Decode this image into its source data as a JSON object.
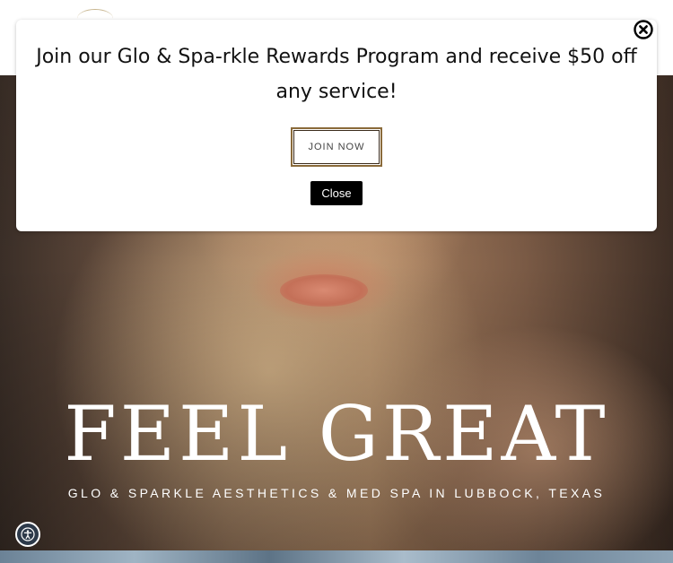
{
  "popup": {
    "message": "Join our Glo & Spa-rkle Rewards Program and receive $50 off any service!",
    "join_label": "JOIN NOW",
    "close_label": "Close"
  },
  "hero": {
    "title": "FEEL GREAT",
    "subtitle": "GLO & SPARKLE AESTHETICS & MED SPA IN LUBBOCK, TEXAS"
  },
  "icons": {
    "close": "close-icon",
    "accessibility": "accessibility-icon"
  },
  "colors": {
    "close_button_bg": "#000000",
    "join_border": "#8a6a3a",
    "accessibility_bg": "#2d3a4a"
  }
}
